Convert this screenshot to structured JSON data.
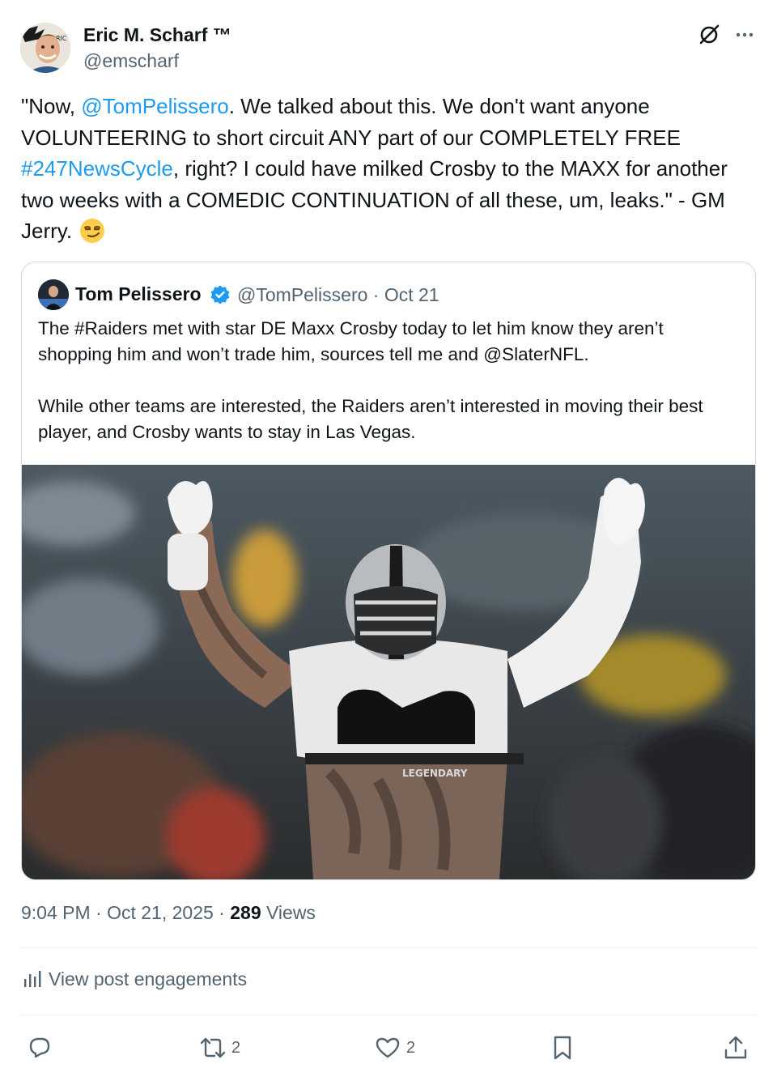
{
  "author": {
    "name": "Eric M. Scharf ™",
    "handle": "@emscharf"
  },
  "tweet": {
    "part1": "\"Now, ",
    "mention": "@TomPelissero",
    "part2": ". We talked about this. We don't want anyone VOLUNTEERING to short circuit ANY part of our COMPLETELY FREE ",
    "hashtag": "#247NewsCycle",
    "part3": ", right? I could have milked Crosby to the MAXX for another two weeks with a COMEDIC CONTINUATION of all these, um, leaks.\" - GM Jerry.",
    "emoji": "smirking-face"
  },
  "quoted": {
    "name": "Tom Pelissero",
    "handle_date": "@TomPelissero · Oct 21",
    "paragraph1": "The #Raiders met with star DE Maxx Crosby today to let him know they aren’t shopping him and won’t trade him, sources tell me and @SlaterNFL.",
    "paragraph2": "While other teams are interested, the Raiders aren’t interested in moving their best player, and Crosby wants to stay in Las Vegas.",
    "image_text": "LEGENDARY"
  },
  "meta": {
    "time_date": "9:04 PM · Oct 21, 2025 · ",
    "views_count": "289",
    "views_label": " Views"
  },
  "engagements_label": "View post engagements",
  "actions": {
    "reply_count": "",
    "repost_count": "2",
    "like_count": "2"
  },
  "colors": {
    "link": "#1d9bf0",
    "secondary_text": "#536471",
    "primary_text": "#0f1419",
    "border": "#cfd9de"
  }
}
